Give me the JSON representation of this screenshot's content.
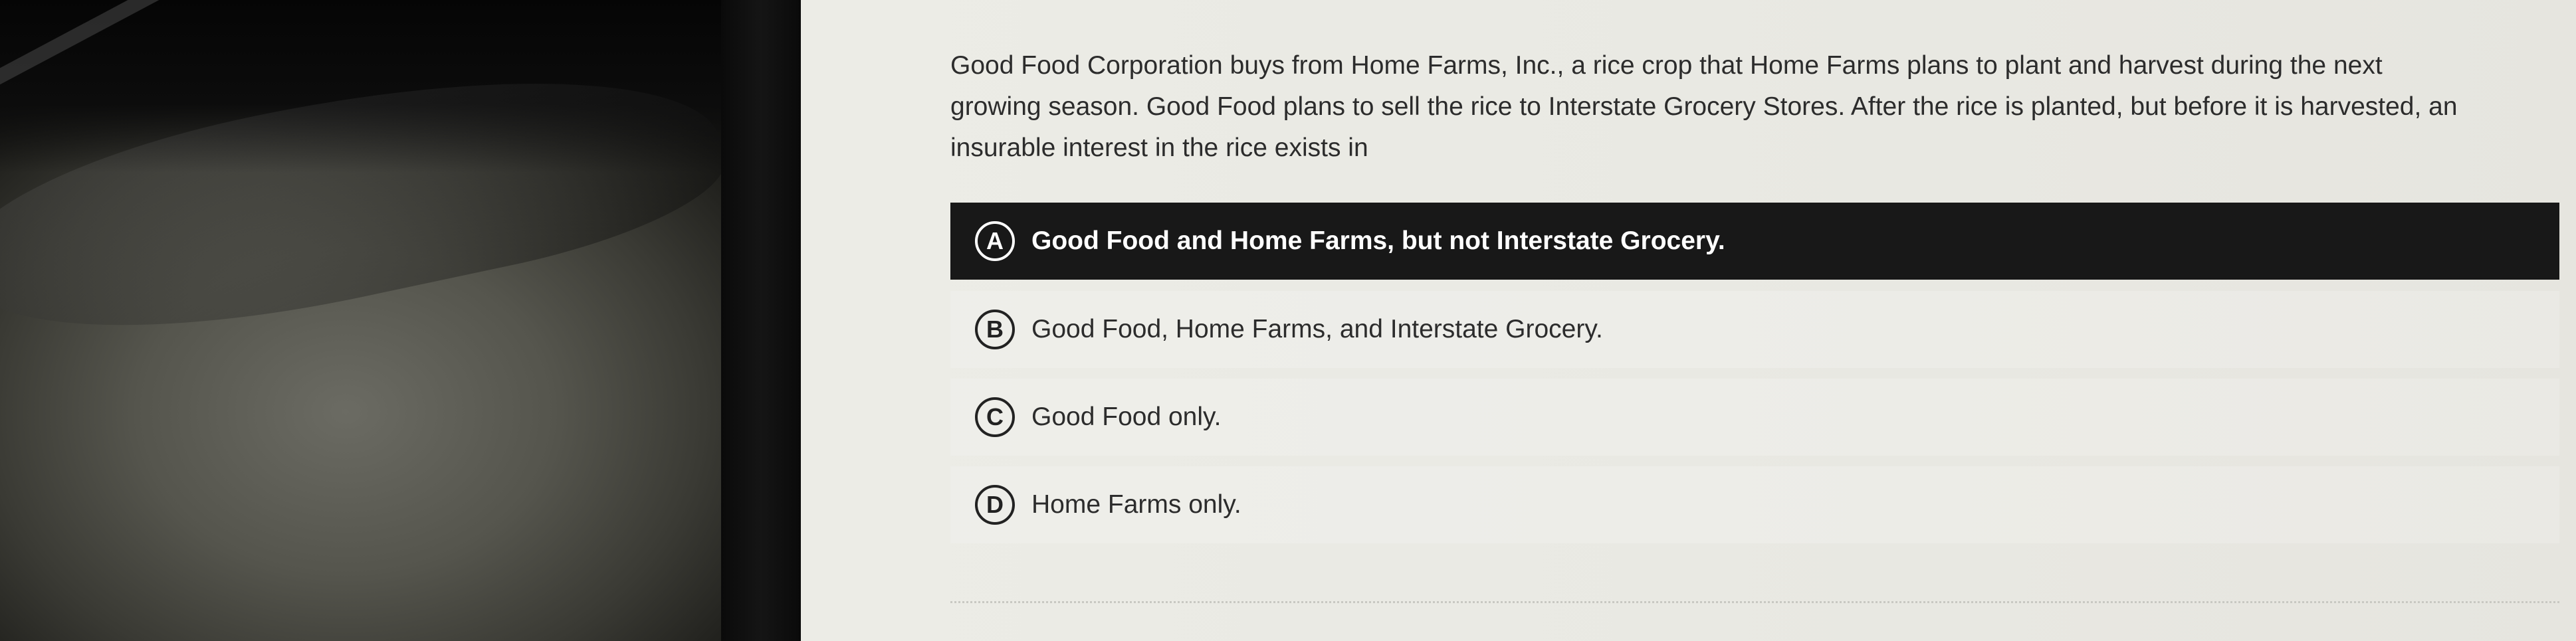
{
  "question": {
    "line1": "Good Food Corporation buys from Home Farms, Inc., a rice crop that Home Farms plans to plant and harvest during the next",
    "line2": "growing season. Good Food plans to sell the rice to Interstate Grocery Stores. After the rice is planted, but before it is harvested, an",
    "line3": "insurable interest in the rice exists in"
  },
  "options": [
    {
      "letter": "A",
      "text": "Good Food and Home Farms, but not Interstate Grocery.",
      "selected": true
    },
    {
      "letter": "B",
      "text": "Good Food, Home Farms, and Interstate Grocery.",
      "selected": false
    },
    {
      "letter": "C",
      "text": "Good Food only.",
      "selected": false
    },
    {
      "letter": "D",
      "text": "Home Farms only.",
      "selected": false
    }
  ],
  "colors": {
    "selected_bg": "#181818",
    "screen_bg": "#ecece6",
    "text": "#2c2c2c"
  }
}
